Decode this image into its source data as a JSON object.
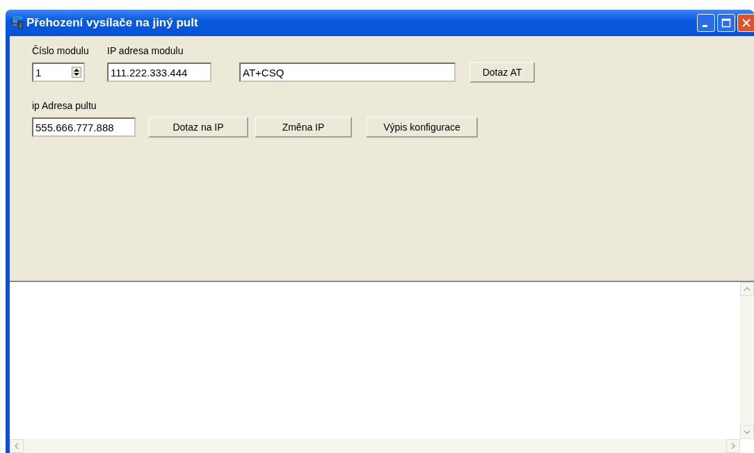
{
  "window": {
    "title": "Přehození vysílače na jiný pult"
  },
  "module": {
    "number_label": "Číslo modulu",
    "number_value": "1",
    "ip_label": "IP adresa modulu",
    "ip_value": "111.222.333.444",
    "at_command": "AT+CSQ",
    "at_button": "Dotaz AT"
  },
  "console": {
    "ip_label": "ip Adresa pultu",
    "ip_value": "555.666.777.888",
    "buttons": [
      "Dotaz na IP",
      "Změna IP",
      "Výpis konfigurace"
    ]
  }
}
